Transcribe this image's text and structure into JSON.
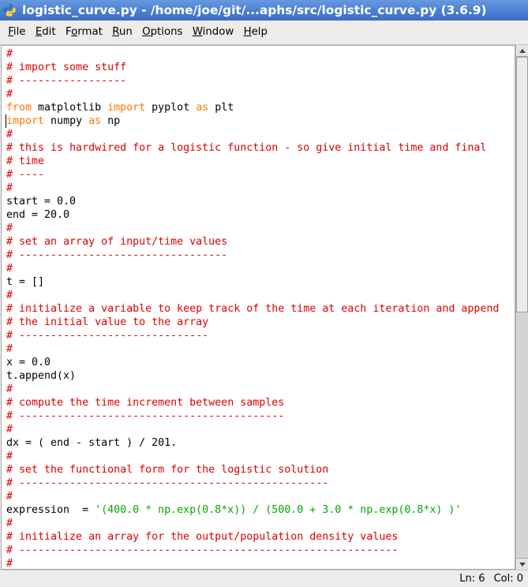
{
  "window": {
    "title": "logistic_curve.py - /home/joe/git/...aphs/src/logistic_curve.py (3.6.9)"
  },
  "icons": {
    "app": "python-icon",
    "scroll_up": "scroll-up-arrow-icon",
    "scroll_down": "scroll-down-arrow-icon"
  },
  "menubar": {
    "items": [
      {
        "label": "File",
        "underline": 0
      },
      {
        "label": "Edit",
        "underline": 0
      },
      {
        "label": "Format",
        "underline": 1
      },
      {
        "label": "Run",
        "underline": 0
      },
      {
        "label": "Options",
        "underline": 0
      },
      {
        "label": "Window",
        "underline": 0
      },
      {
        "label": "Help",
        "underline": 0
      }
    ]
  },
  "syntax_colors": {
    "comment": "#dd0000",
    "keyword": "#ff7700",
    "string": "#00aa00",
    "plain": "#000000"
  },
  "editor": {
    "lines": [
      [
        {
          "comment": "#"
        }
      ],
      [
        {
          "comment": "# import some stuff"
        }
      ],
      [
        {
          "comment": "# -----------------"
        }
      ],
      [
        {
          "comment": "#"
        }
      ],
      [
        {
          "keyword": "from"
        },
        {
          "plain": " matplotlib "
        },
        {
          "keyword": "import"
        },
        {
          "plain": " pyplot "
        },
        {
          "keyword": "as"
        },
        {
          "plain": " plt"
        }
      ],
      [
        {
          "keyword": "import"
        },
        {
          "plain": " numpy "
        },
        {
          "keyword": "as"
        },
        {
          "plain": " np"
        }
      ],
      [
        {
          "comment": "#"
        }
      ],
      [
        {
          "comment": "# this is hardwired for a logistic function - so give initial time and final"
        }
      ],
      [
        {
          "comment": "# time"
        }
      ],
      [
        {
          "comment": "# ----"
        }
      ],
      [
        {
          "comment": "#"
        }
      ],
      [
        {
          "plain": "start = 0.0"
        }
      ],
      [
        {
          "plain": "end = 20.0"
        }
      ],
      [
        {
          "comment": "#"
        }
      ],
      [
        {
          "comment": "# set an array of input/time values"
        }
      ],
      [
        {
          "comment": "# ---------------------------------"
        }
      ],
      [
        {
          "comment": "#"
        }
      ],
      [
        {
          "plain": "t = []"
        }
      ],
      [
        {
          "comment": "#"
        }
      ],
      [
        {
          "comment": "# initialize a variable to keep track of the time at each iteration and append"
        }
      ],
      [
        {
          "comment": "# the initial value to the array"
        }
      ],
      [
        {
          "comment": "# ------------------------------"
        }
      ],
      [
        {
          "comment": "#"
        }
      ],
      [
        {
          "plain": "x = 0.0"
        }
      ],
      [
        {
          "plain": "t.append(x)"
        }
      ],
      [
        {
          "comment": "#"
        }
      ],
      [
        {
          "comment": "# compute the time increment between samples"
        }
      ],
      [
        {
          "comment": "# ------------------------------------------"
        }
      ],
      [
        {
          "comment": "#"
        }
      ],
      [
        {
          "plain": "dx = ( end - start ) / 201."
        }
      ],
      [
        {
          "comment": "#"
        }
      ],
      [
        {
          "comment": "# set the functional form for the logistic solution"
        }
      ],
      [
        {
          "comment": "# -------------------------------------------------"
        }
      ],
      [
        {
          "comment": "#"
        }
      ],
      [
        {
          "plain": "expression  = "
        },
        {
          "string": "'(400.0 * np.exp(0.8*x)) / (500.0 + 3.0 * np.exp(0.8*x) )'"
        }
      ],
      [
        {
          "comment": "#"
        }
      ],
      [
        {
          "comment": "# initialize an array for the output/population density values"
        }
      ],
      [
        {
          "comment": "# ------------------------------------------------------------"
        }
      ],
      [
        {
          "comment": "#"
        }
      ]
    ],
    "cursor": {
      "line": 6,
      "col": 0
    },
    "scrollbar": {
      "view_first": 0.0,
      "view_last": 0.51
    }
  },
  "status": {
    "line": "Ln: 6",
    "col": "Col: 0"
  }
}
